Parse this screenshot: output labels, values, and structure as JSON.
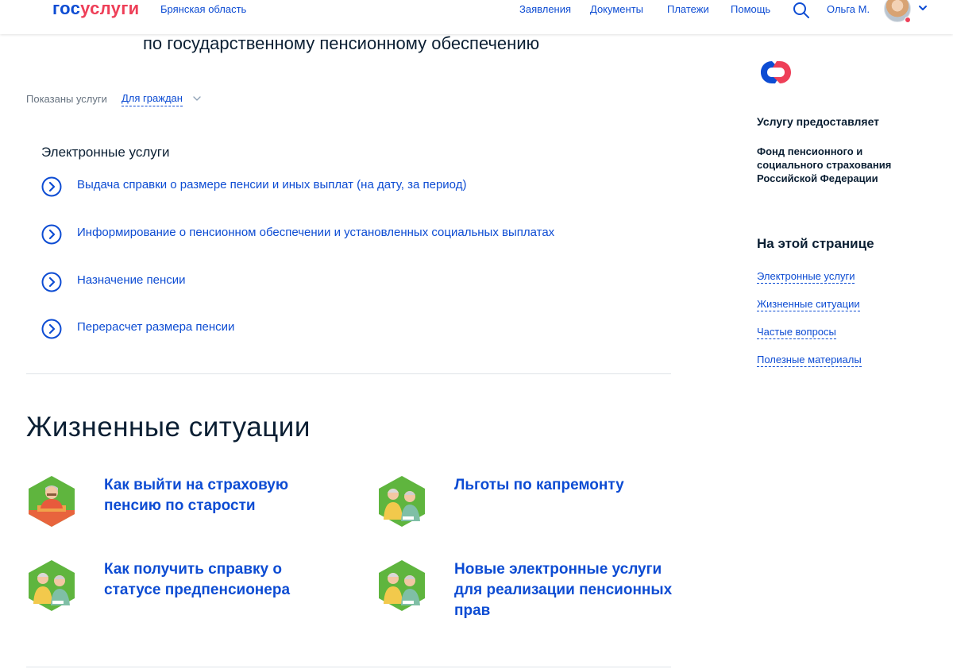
{
  "header": {
    "logo_part1": "гос",
    "logo_part2": "услуги",
    "region": "Брянская область",
    "nav": [
      "Заявления",
      "Документы",
      "Платежи",
      "Помощь"
    ],
    "search_icon": "search-icon",
    "user_name": "Ольга М.",
    "colors": {
      "brand_blue": "#0d4cd3",
      "brand_red": "#ee3f58"
    }
  },
  "main": {
    "page_title": "по государственному пенсионному обеспечению",
    "filter_label": "Показаны услуги",
    "filter_value": "Для граждан",
    "e_services_title": "Электронные услуги",
    "e_services": [
      "Выдача справки о размере пенсии и иных выплат (на дату, за период)",
      "Информирование о пенсионном обеспечении и установленных социальных выплатах",
      "Назначение пенсии",
      "Перерасчет размера пенсии"
    ],
    "life_title": "Жизненные ситуации",
    "life_situations": [
      {
        "text": "Как выйти на страховую пенсию по старости",
        "icon": "pensioner-icon"
      },
      {
        "text": "Льготы по капремонту",
        "icon": "elderly-couple-icon"
      },
      {
        "text": "Как получить справку о статусе предпенсионера",
        "icon": "elderly-couple-icon"
      },
      {
        "text": "Новые электронные услуги для реализации пенсионных прав",
        "icon": "elderly-couple-icon"
      }
    ]
  },
  "sidebar": {
    "provider_label": "Услугу предоставляет",
    "provider_name": "Фонд пенсионного и социального страхования Российской Федерации",
    "on_page_title": "На этой странице",
    "anchors": [
      "Электронные услуги",
      "Жизненные ситуации",
      "Частые вопросы",
      "Полезные материалы"
    ]
  }
}
